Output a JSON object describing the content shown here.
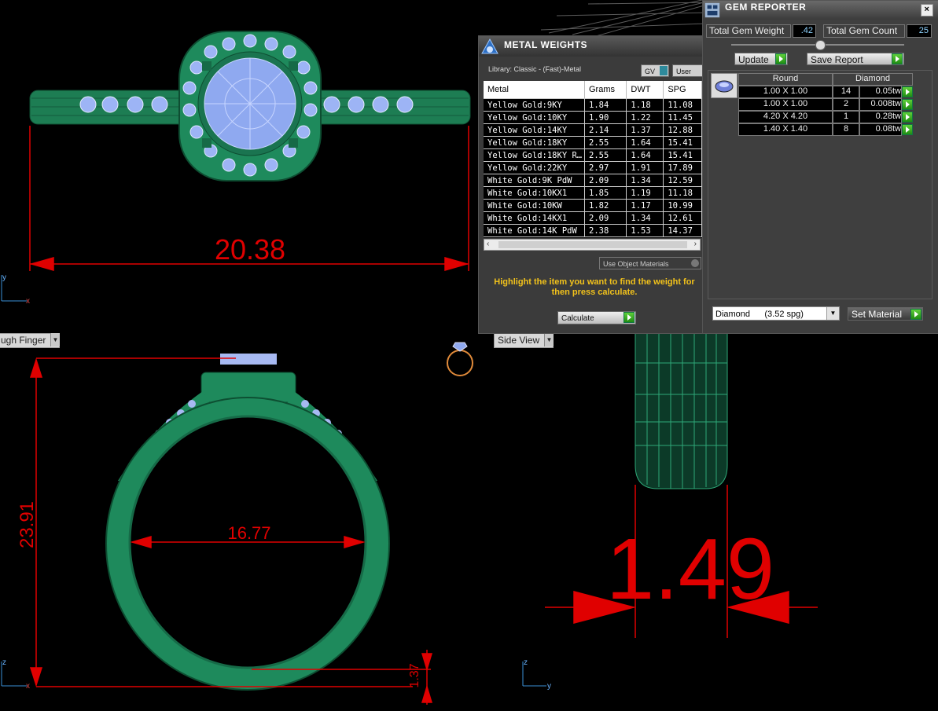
{
  "viewports": {
    "top": {
      "dimension": "20.38",
      "axis_y": "y",
      "axis_x": "x"
    },
    "front": {
      "label": "ugh Finger",
      "dim_height": "23.91",
      "dim_inner": "16.77",
      "dim_band": "1.37",
      "axis_y": "z",
      "axis_x": "x"
    },
    "side": {
      "label": "Side View",
      "dimension": "1.49",
      "axis_y": "z",
      "axis_x": "y"
    }
  },
  "metal_weights": {
    "title": "METAL WEIGHTS",
    "library": "Library: Classic - (Fast)-Metal",
    "gv_label": "GV",
    "user_label": "User",
    "columns": [
      "Metal",
      "Grams",
      "DWT",
      "SPG"
    ],
    "rows": [
      [
        "Yellow Gold:9KY",
        "1.84",
        "1.18",
        "11.08"
      ],
      [
        "Yellow Gold:10KY",
        "1.90",
        "1.22",
        "11.45"
      ],
      [
        "Yellow Gold:14KY",
        "2.14",
        "1.37",
        "12.88"
      ],
      [
        "Yellow Gold:18KY",
        "2.55",
        "1.64",
        "15.41"
      ],
      [
        "Yellow Gold:18KY R…",
        "2.55",
        "1.64",
        "15.41"
      ],
      [
        "Yellow Gold:22KY",
        "2.97",
        "1.91",
        "17.89"
      ],
      [
        "White Gold:9K PdW",
        "2.09",
        "1.34",
        "12.59"
      ],
      [
        "White Gold:10KX1",
        "1.85",
        "1.19",
        "11.18"
      ],
      [
        "White Gold:10KW",
        "1.82",
        "1.17",
        "10.99"
      ],
      [
        "White Gold:14KX1",
        "2.09",
        "1.34",
        "12.61"
      ],
      [
        "White Gold:14K PdW",
        "2.38",
        "1.53",
        "14.37"
      ]
    ],
    "use_object_materials": "Use Object Materials",
    "hint": "Highlight the item you want to find the weight for then press calculate.",
    "calculate": "Calculate"
  },
  "gem_reporter": {
    "title": "GEM REPORTER",
    "close": "x",
    "total_weight_label": "Total Gem Weight",
    "total_weight_value": ".42",
    "total_count_label": "Total Gem Count",
    "total_count_value": "25",
    "update": "Update",
    "save_report": "Save Report",
    "header_shape": "Round",
    "header_material": "Diamond",
    "rows": [
      {
        "size": "1.00 X 1.00",
        "count": "14",
        "weight": "0.05tw"
      },
      {
        "size": "1.00 X 1.00",
        "count": "2",
        "weight": "0.008tw"
      },
      {
        "size": "4.20 X 4.20",
        "count": "1",
        "weight": "0.28tw"
      },
      {
        "size": "1.40 X 1.40",
        "count": "8",
        "weight": "0.08tw"
      }
    ],
    "material_select": "Diamond      (3.52 spg)",
    "set_material": "Set Material"
  },
  "colors": {
    "metal": "#1e8a5c",
    "gem": "#8fa9f0",
    "dim": "#e00000"
  }
}
